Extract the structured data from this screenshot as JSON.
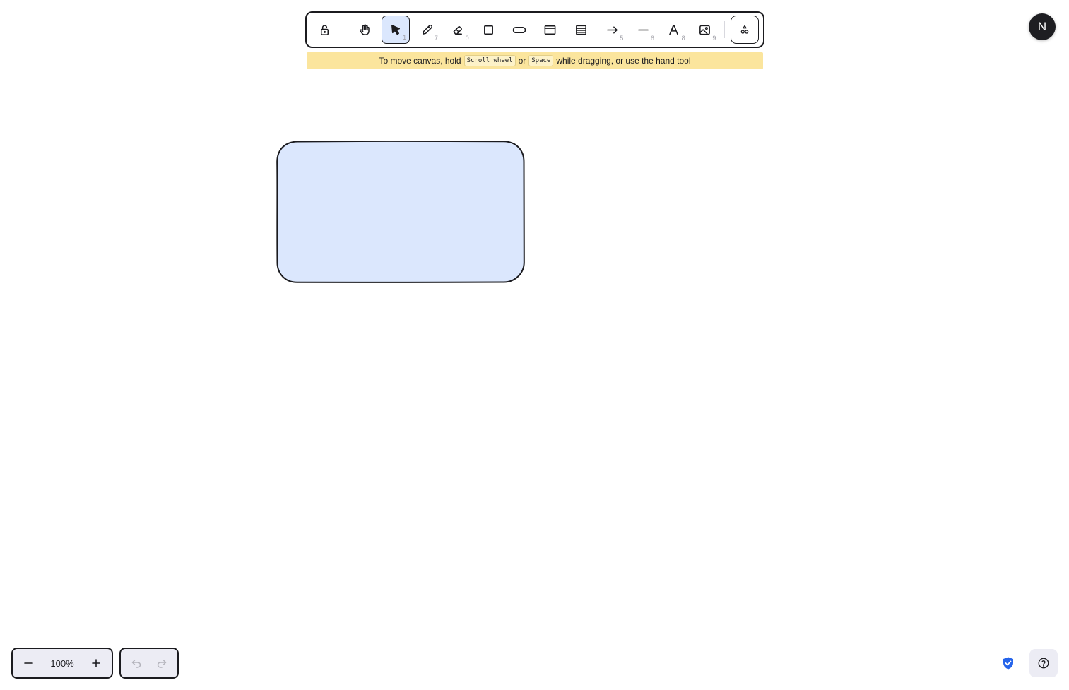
{
  "toolbar": {
    "tools": [
      {
        "name": "lock",
        "key": ""
      },
      {
        "name": "hand",
        "key": ""
      },
      {
        "name": "selection",
        "key": "1"
      },
      {
        "name": "freedraw",
        "key": "7"
      },
      {
        "name": "eraser",
        "key": "0"
      },
      {
        "name": "rectangle",
        "key": ""
      },
      {
        "name": "rounded-rectangle",
        "key": ""
      },
      {
        "name": "frame",
        "key": ""
      },
      {
        "name": "table",
        "key": ""
      },
      {
        "name": "arrow",
        "key": "5"
      },
      {
        "name": "line",
        "key": "6"
      },
      {
        "name": "text",
        "key": "8"
      },
      {
        "name": "image",
        "key": "9"
      },
      {
        "name": "more-tools",
        "key": ""
      }
    ],
    "active_tool": "selection",
    "active_color": "#dbe7fd"
  },
  "hint": {
    "prefix": "To move canvas, hold",
    "key1": "Scroll wheel",
    "middle": "or",
    "key2": "Space",
    "suffix": "while dragging, or use the hand tool",
    "background": "#fbe59d"
  },
  "avatar": {
    "initial": "N"
  },
  "canvas": {
    "shape": {
      "type": "rounded-rectangle",
      "fill": "#dbe7fd",
      "stroke": "#1b1b1f"
    }
  },
  "zoom": {
    "value": "100%"
  },
  "colors": {
    "accent": "#dbe7fd",
    "stroke": "#1b1b1f",
    "shield": "#2564eb"
  }
}
